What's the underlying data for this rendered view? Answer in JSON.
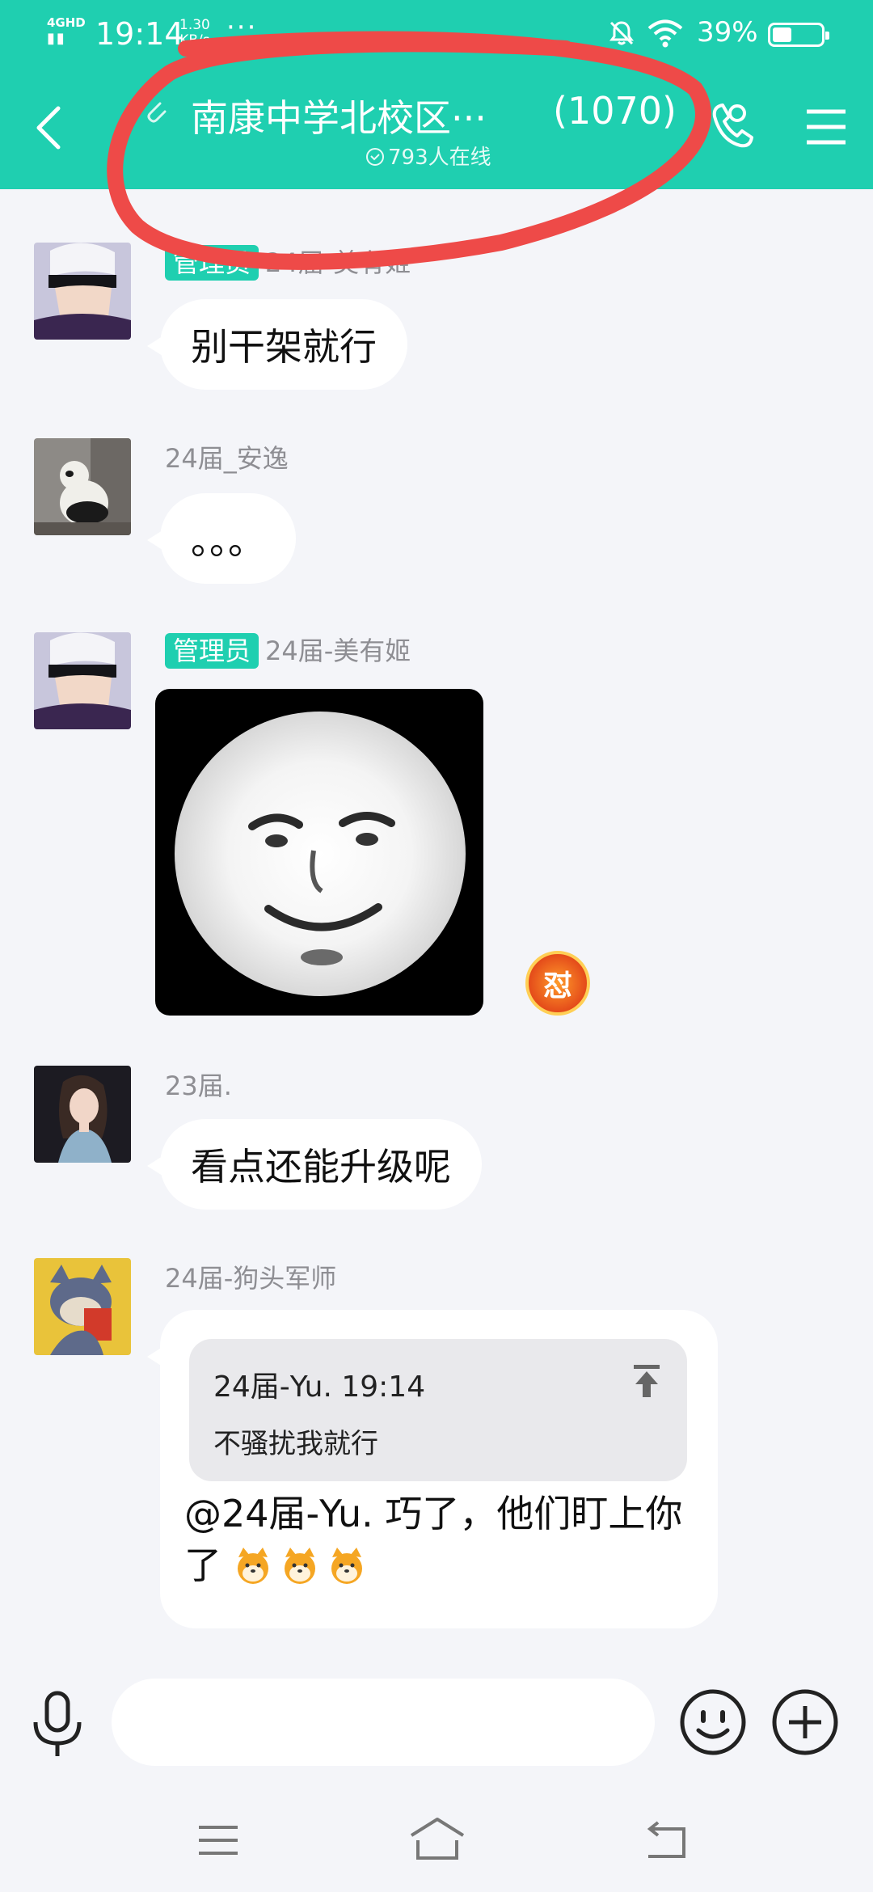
{
  "status_bar": {
    "network": "4GHD",
    "time": "19:14",
    "speed_value": "1.30",
    "speed_unit": "KB/s",
    "more": "···",
    "battery_percent": "39%",
    "battery_level": 0.39
  },
  "header": {
    "title": "南康中学北校区···",
    "member_count": "(1070)",
    "online": "793人在线"
  },
  "messages": [
    {
      "sender": "24届-美有姬",
      "badge": "管理员",
      "text": "别干架就行"
    },
    {
      "sender": "24届_安逸",
      "text": "。。。"
    },
    {
      "sender": "24届-美有姬",
      "badge": "管理员",
      "reaction": "怼"
    },
    {
      "sender": "23届.",
      "text": "看点还能升级呢"
    },
    {
      "sender": "24届-狗头军师",
      "quote_header": "24届-Yu. 19:14",
      "quote_text": "不骚扰我就行",
      "text": "@24届-Yu. 巧了，他们盯上你了"
    }
  ],
  "input": {
    "placeholder": ""
  },
  "colors": {
    "accent": "#1fcfb0",
    "annotation": "#ee4a48",
    "background": "#f4f5f9"
  }
}
